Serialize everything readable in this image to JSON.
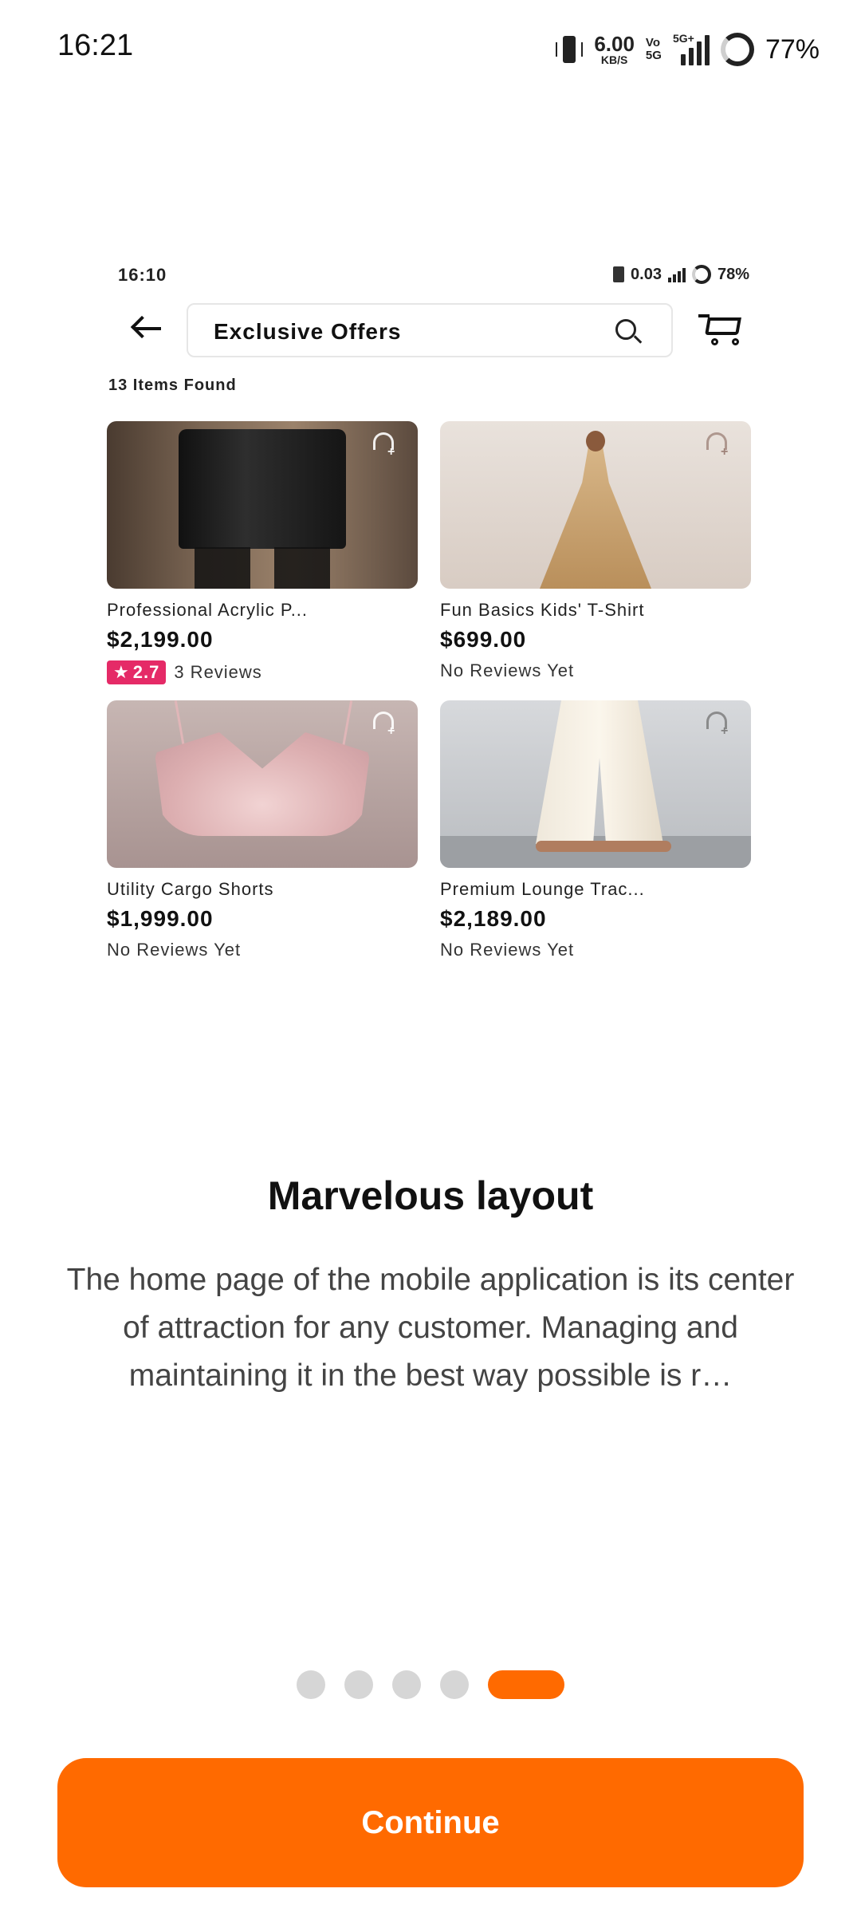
{
  "status_bar": {
    "time": "16:21",
    "net_speed": "6.00",
    "net_speed_unit": "KB/S",
    "volte_top": "Vo",
    "volte_bottom": "5G",
    "network": "5G+",
    "battery": "77%"
  },
  "mockup": {
    "status": {
      "time": "16:10",
      "speed": "0.03",
      "battery": "78%"
    },
    "search": {
      "value": "Exclusive Offers"
    },
    "items_found": "13 Items Found",
    "products": [
      {
        "title": "Professional Acrylic P...",
        "price": "$2,199.00",
        "rating": "2.7",
        "reviews": "3 Reviews"
      },
      {
        "title": "Fun Basics Kids' T-Shirt",
        "price": "$699.00",
        "reviews": "No Reviews Yet"
      },
      {
        "title": "Utility Cargo Shorts",
        "price": "$1,999.00",
        "reviews": "No Reviews Yet"
      },
      {
        "title": "Premium Lounge Trac...",
        "price": "$2,189.00",
        "reviews": "No Reviews Yet"
      }
    ]
  },
  "onboarding": {
    "title": "Marvelous layout",
    "description": "The home page of the mobile application is its center of attraction for any customer. Managing and maintaining it in the best way possible is r…",
    "page_total": 5,
    "page_active": 5
  },
  "actions": {
    "continue_label": "Continue"
  },
  "colors": {
    "accent": "#ff6a00",
    "rating_badge": "#e52a67",
    "dot_inactive": "#d6d6d6"
  }
}
